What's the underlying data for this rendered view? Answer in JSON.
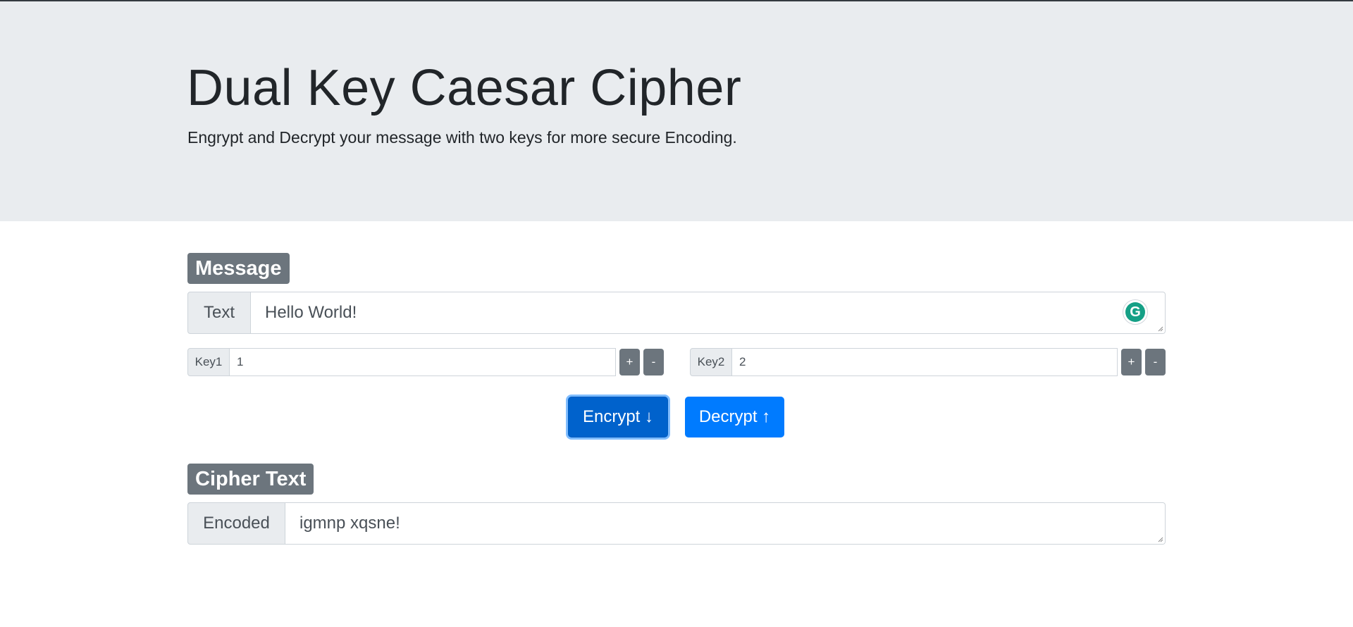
{
  "header": {
    "title": "Dual Key Caesar Cipher",
    "subtitle": "Engrypt and Decrypt your message with two keys for more secure Encoding."
  },
  "message": {
    "section_label": "Message",
    "addon_label": "Text",
    "value": "Hello World!"
  },
  "key1": {
    "label": "Key1",
    "value": "1",
    "plus": "+",
    "minus": "-"
  },
  "key2": {
    "label": "Key2",
    "value": "2",
    "plus": "+",
    "minus": "-"
  },
  "actions": {
    "encrypt_label": "Encrypt ↓",
    "decrypt_label": "Decrypt ↑"
  },
  "cipher": {
    "section_label": "Cipher Text",
    "addon_label": "Encoded",
    "value": "igmnp xqsne!"
  },
  "grammarly": {
    "icon": "grammarly-icon",
    "glyph": "G",
    "color": "#15a086"
  },
  "colors": {
    "primary": "#007bff",
    "primary_active": "#0062cc",
    "secondary": "#6c757d",
    "jumbotron": "#e9ecef"
  }
}
